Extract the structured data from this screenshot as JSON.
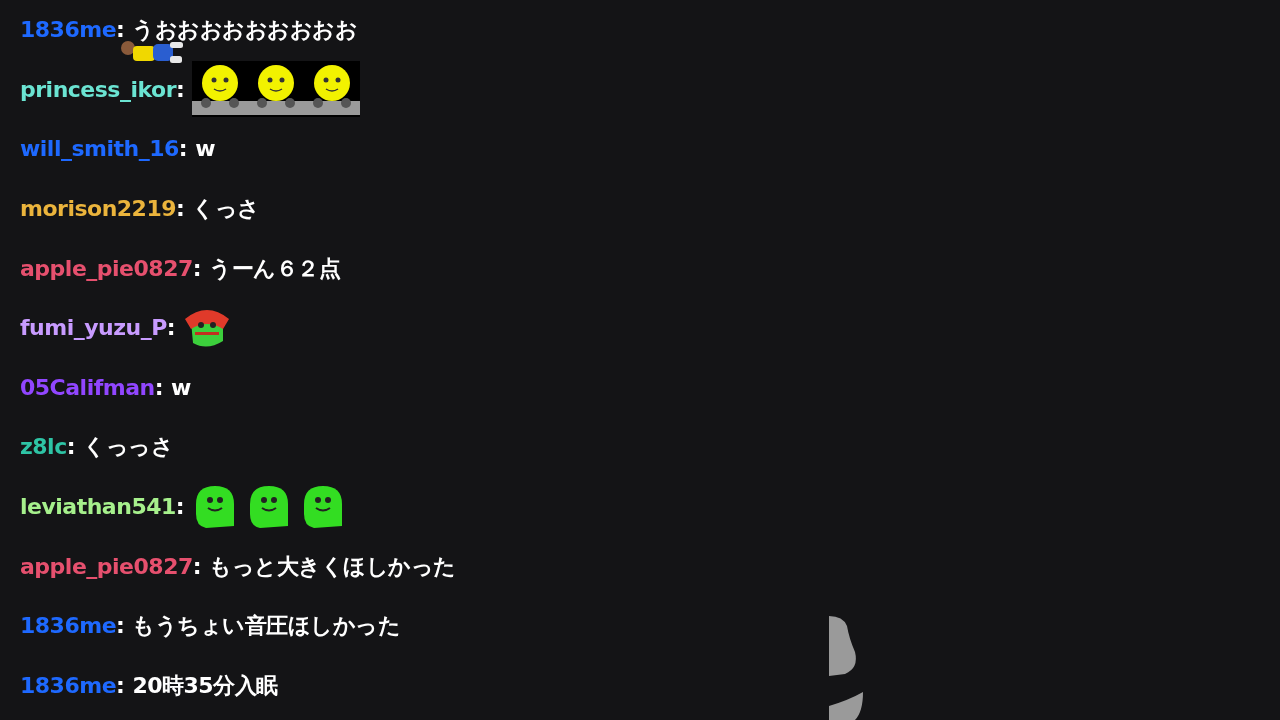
{
  "messages": [
    {
      "user": "1836me",
      "separator": ":",
      "color": "#1e69ff",
      "kind": "text",
      "text": "うおおおおおおおおお"
    },
    {
      "user": "princess_ikor",
      "separator": ":",
      "color": "#6be4d2",
      "kind": "emote",
      "emotes": [
        {
          "kind": "bots"
        }
      ]
    },
    {
      "user": "will_smith_16",
      "separator": ":",
      "color": "#1e69ff",
      "kind": "text",
      "text": "w"
    },
    {
      "user": "morison2219",
      "separator": ":",
      "color": "#ebb43c",
      "kind": "text",
      "text": "くっさ"
    },
    {
      "user": "apple_pie0827",
      "separator": ":",
      "color": "#e6506e",
      "kind": "text",
      "text": "うーん６２点"
    },
    {
      "user": "fumi_yuzu_P",
      "separator": ":",
      "color": "#c89bff",
      "kind": "emote",
      "emotes": [
        {
          "kind": "hatblob"
        }
      ]
    },
    {
      "user": "05Califman",
      "separator": ":",
      "color": "#9146ff",
      "kind": "text",
      "text": "w"
    },
    {
      "user": "z8lc",
      "separator": ":",
      "color": "#2ec4a5",
      "kind": "text",
      "text": "くっっさ"
    },
    {
      "user": "leviathan541",
      "separator": ":",
      "color": "#a6f08c",
      "kind": "emote",
      "emotes": [
        {
          "kind": "blob"
        },
        {
          "kind": "blob"
        },
        {
          "kind": "blob"
        }
      ]
    },
    {
      "user": "apple_pie0827",
      "separator": ":",
      "color": "#e6506e",
      "kind": "text",
      "text": "もっと大きくほしかった"
    },
    {
      "user": "1836me",
      "separator": ":",
      "color": "#1e69ff",
      "kind": "text",
      "text": "もうちょい音圧ほしかった"
    },
    {
      "user": "1836me",
      "separator": ":",
      "color": "#1e69ff",
      "kind": "text",
      "text": "20時35分入眠"
    }
  ]
}
